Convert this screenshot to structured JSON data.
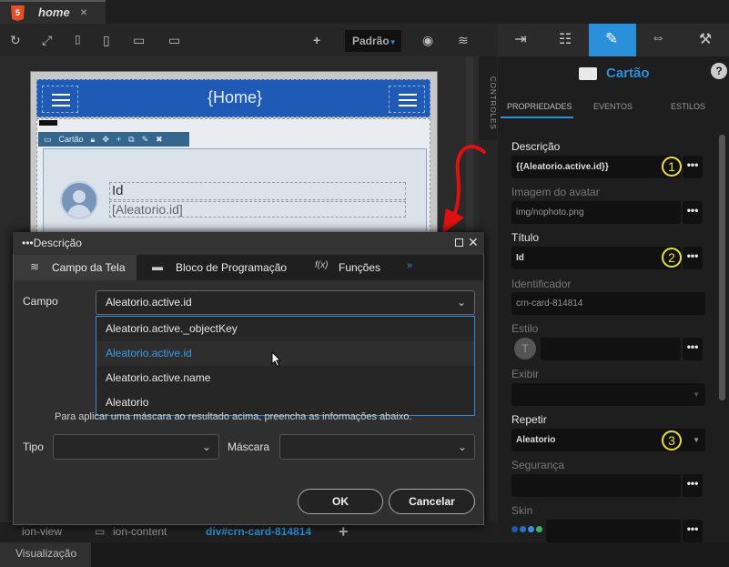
{
  "tab": {
    "label": "home",
    "close": "×",
    "html_badge": "5"
  },
  "toolbar": {
    "preset": "Padrão"
  },
  "preview": {
    "header_title": "{Home}",
    "card_bar_label": "Cartão",
    "card_title": "Id",
    "card_subtitle": "[Aleatorio.id]"
  },
  "side_strip": {
    "label": "CONTROLES"
  },
  "breadcrumb": {
    "items": [
      "ion-view",
      "ion-content",
      "div#crn-card-814814"
    ],
    "add": "+"
  },
  "status": {
    "label": "Visualização"
  },
  "panel": {
    "title": "Cartão",
    "help": "?",
    "tabs": [
      "PROPRIEDADES",
      "EVENTOS",
      "ESTILOS"
    ],
    "fields": {
      "descricao_label": "Descrição",
      "descricao_value": "{{Aleatorio.active.id}}",
      "imagem_label": "Imagem do avatar",
      "imagem_value": "img/nophoto.png",
      "titulo_label": "Título",
      "titulo_value": "Id",
      "identificador_label": "Identificador",
      "identificador_value": "crn-card-814814",
      "estilo_label": "Estilo",
      "estilo_avatar": "T",
      "exibir_label": "Exibir",
      "repetir_label": "Repetir",
      "repetir_value": "Aleatorio",
      "seguranca_label": "Segurança",
      "skin_label": "Skin"
    },
    "more_button": "•••",
    "markers": [
      "1",
      "2",
      "3"
    ],
    "accent": "#2b8fd9",
    "marker_color": "#e8e03a"
  },
  "dialog": {
    "title": "Descrição",
    "tabs": [
      "Campo da Tela",
      "Bloco de Programação",
      "Funções",
      "»"
    ],
    "campo_label": "Campo",
    "campo_value": "Aleatorio.active.id",
    "options": [
      "Aleatorio.active._objectKey",
      "Aleatorio.active.id",
      "Aleatorio.active.name",
      "Aleatorio"
    ],
    "selected_option": "Aleatorio.active.id",
    "hint": "Para aplicar uma máscara ao resultado acima, preencha as informações abaixo.",
    "tipo_label": "Tipo",
    "mascara_label": "Máscara",
    "ok": "OK",
    "cancel": "Cancelar"
  }
}
